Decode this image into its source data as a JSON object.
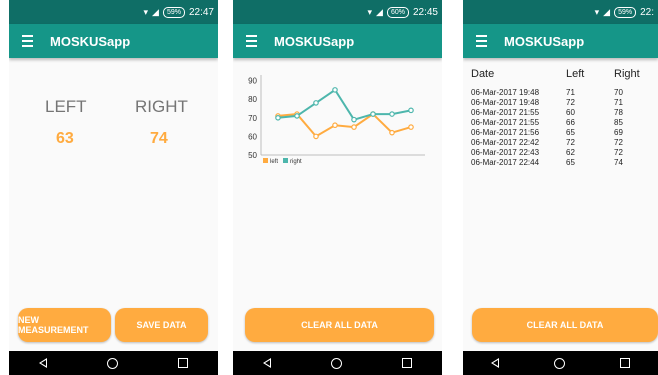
{
  "status": {
    "screens": [
      {
        "battery": "59%",
        "time": "22:47"
      },
      {
        "battery": "60%",
        "time": "22:45"
      },
      {
        "battery": "59%",
        "time": "22:"
      }
    ]
  },
  "app": {
    "title": "MOSKUSapp"
  },
  "measure_screen": {
    "left_label": "LEFT",
    "right_label": "RIGHT",
    "left_value": "63",
    "right_value": "74",
    "new_measurement_label": "NEW MEASUREMENT",
    "save_data_label": "SAVE DATA"
  },
  "chart_screen": {
    "clear_label": "CLEAR ALL DATA"
  },
  "chart_data": {
    "type": "line",
    "x": [
      1,
      2,
      3,
      4,
      5,
      6,
      7,
      8
    ],
    "series": [
      {
        "name": "left",
        "color": "#ffab40",
        "values": [
          71,
          72,
          60,
          66,
          65,
          72,
          62,
          65
        ]
      },
      {
        "name": "right",
        "color": "#4db6ac",
        "values": [
          70,
          71,
          78,
          85,
          69,
          72,
          72,
          74
        ]
      }
    ],
    "yticks": [
      "50",
      "60",
      "70",
      "80",
      "90"
    ],
    "ylim": [
      50,
      93
    ],
    "legend": "bottom-left"
  },
  "table_screen": {
    "headers": {
      "date": "Date",
      "left": "Left",
      "right": "Right"
    },
    "rows": [
      {
        "date": "06-Mar-2017 19:48",
        "left": "71",
        "right": "70"
      },
      {
        "date": "06-Mar-2017 19:48",
        "left": "72",
        "right": "71"
      },
      {
        "date": "06-Mar-2017 21:55",
        "left": "60",
        "right": "78"
      },
      {
        "date": "06-Mar-2017 21:55",
        "left": "66",
        "right": "85"
      },
      {
        "date": "06-Mar-2017 21:56",
        "left": "65",
        "right": "69"
      },
      {
        "date": "06-Mar-2017 22:42",
        "left": "72",
        "right": "72"
      },
      {
        "date": "06-Mar-2017 22:43",
        "left": "62",
        "right": "72"
      },
      {
        "date": "06-Mar-2017 22:44",
        "left": "65",
        "right": "74"
      }
    ],
    "clear_label": "CLEAR ALL DATA"
  }
}
